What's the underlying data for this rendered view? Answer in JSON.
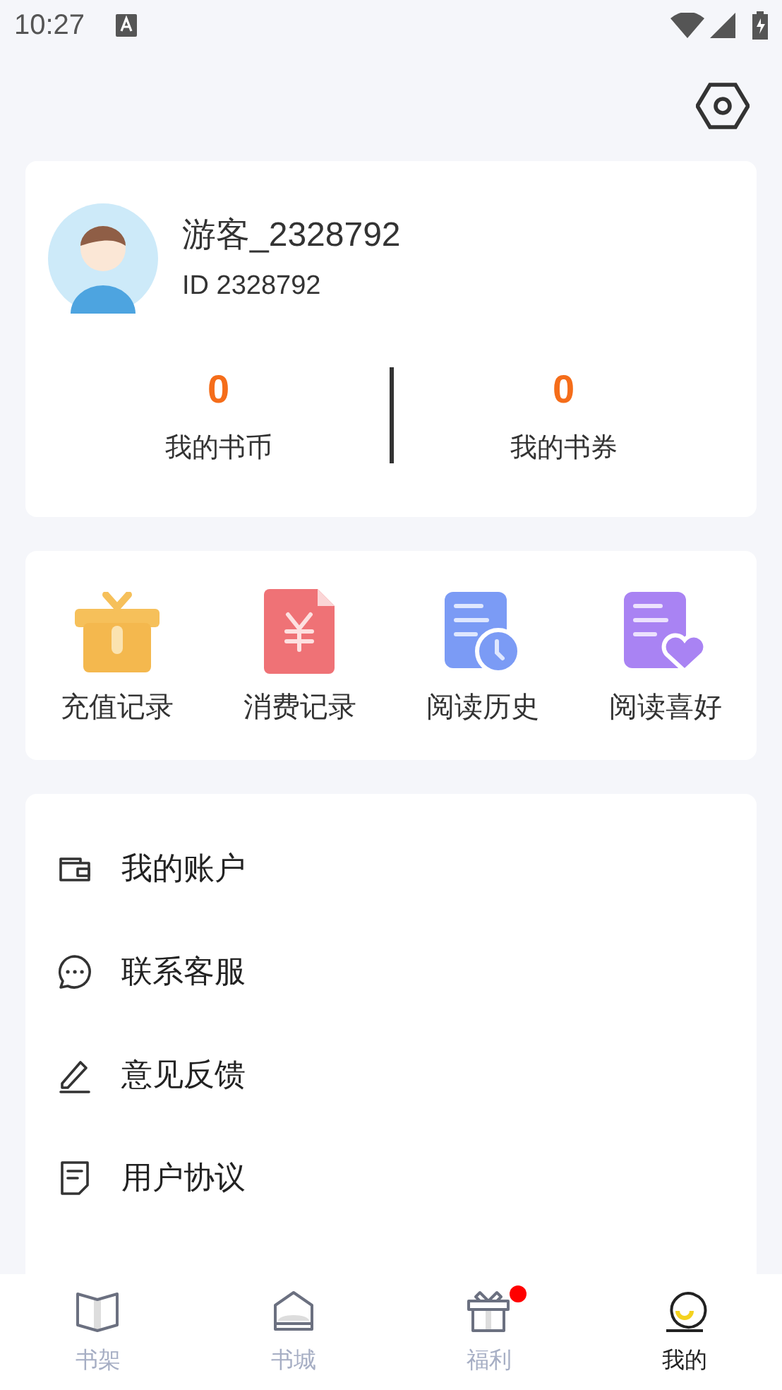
{
  "status_bar": {
    "time": "10:27"
  },
  "profile": {
    "name": "游客_2328792",
    "id": "ID 2328792"
  },
  "stats": [
    {
      "value": "0",
      "label": "我的书币"
    },
    {
      "value": "0",
      "label": "我的书券"
    }
  ],
  "shortcuts": [
    {
      "kind": "gift",
      "label": "充值记录"
    },
    {
      "kind": "bill",
      "label": "消费记录"
    },
    {
      "kind": "history",
      "label": "阅读历史"
    },
    {
      "kind": "favorite",
      "label": "阅读喜好"
    }
  ],
  "menu": [
    {
      "kind": "wallet",
      "label": "我的账户"
    },
    {
      "kind": "chat",
      "label": "联系客服"
    },
    {
      "kind": "edit",
      "label": "意见反馈"
    },
    {
      "kind": "doc",
      "label": "用户协议"
    }
  ],
  "nav": [
    {
      "kind": "shelf",
      "label": "书架",
      "selected": false,
      "badge": false
    },
    {
      "kind": "store",
      "label": "书城",
      "selected": false,
      "badge": false
    },
    {
      "kind": "gift",
      "label": "福利",
      "selected": false,
      "badge": true
    },
    {
      "kind": "me",
      "label": "我的",
      "selected": true,
      "badge": false
    }
  ]
}
